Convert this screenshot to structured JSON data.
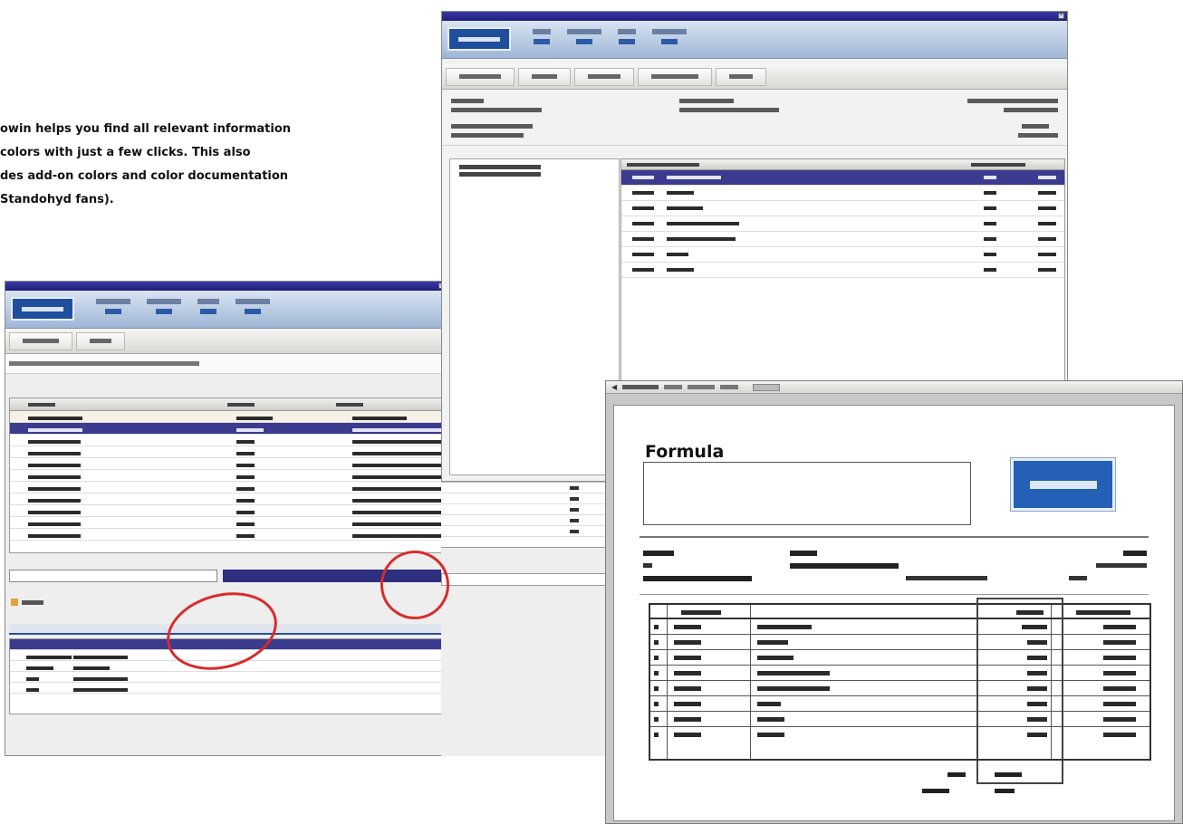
{
  "caption": {
    "lines": [
      "owin helps you find all relevant information",
      " colors with just a few clicks. This also",
      "des add-on colors and color documentation",
      "Standohyd fans)."
    ]
  },
  "print_preview": {
    "title": "Formula"
  },
  "colors": {
    "titlebar": "#1e1e7a",
    "selection": "#3b3b8f",
    "logo_blue": "#2460b6",
    "annotation_circle": "#d92b2b"
  },
  "icons": [
    "close-icon",
    "logo-icon"
  ]
}
